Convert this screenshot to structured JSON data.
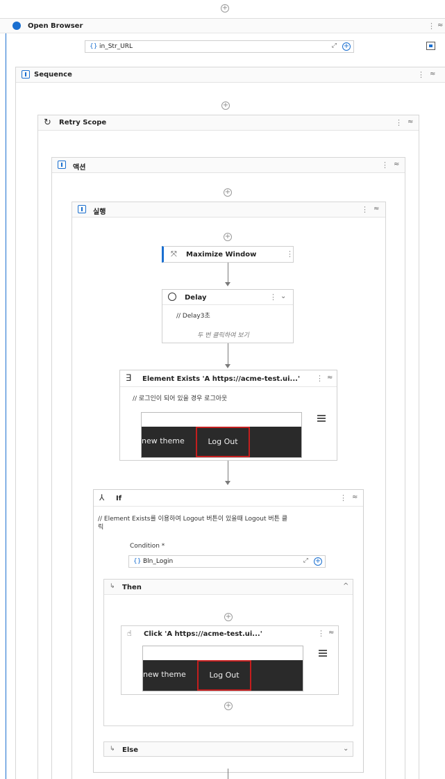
{
  "open_browser": {
    "title": "Open Browser",
    "url_field": "in_Str_URL"
  },
  "sequence": {
    "title": "Sequence"
  },
  "retry_scope": {
    "title": "Retry Scope"
  },
  "action": {
    "title": "액션"
  },
  "execute": {
    "title": "실행"
  },
  "maximize": {
    "title": "Maximize Window"
  },
  "delay": {
    "title": "Delay",
    "comment": "// Delay3초",
    "hint": "두 번 클릭하여 보기"
  },
  "element_exists": {
    "title": "Element Exists 'A  https://acme-test.ui...'",
    "comment": "// 로그인이 되어 있을 경우 로그아웃"
  },
  "screenshot": {
    "new_theme": "new theme",
    "logout": "Log Out"
  },
  "if_block": {
    "title": "If",
    "comment_line1": "// Element Exists를 이용하여 Logout 버튼이 있을때 Logout 버튼 클",
    "comment_line2": "릭",
    "condition_label": "Condition *",
    "condition_value": "Bln_Login"
  },
  "then": {
    "title": "Then"
  },
  "click": {
    "title": "Click 'A  https://acme-test.ui...'"
  },
  "else_block": {
    "title": "Else"
  },
  "glyphs": {
    "plus": "+",
    "dots": "⋮",
    "collapse": "≈",
    "chevron_up": "^",
    "chevron_down": "⌄",
    "var_icon": "{}",
    "expand": "⤢"
  }
}
